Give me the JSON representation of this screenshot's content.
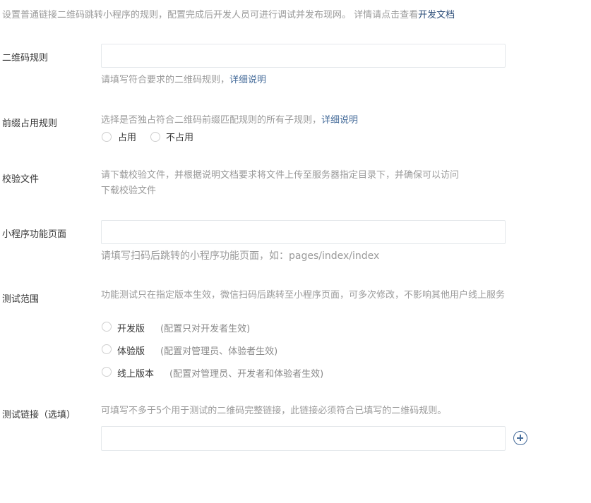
{
  "intro": {
    "text": "设置普通链接二维码跳转小程序的规则，配置完成后开发人员可进行调试并发布现网。 详情请点击查看",
    "link": "开发文档"
  },
  "qr_rule": {
    "label": "二维码规则",
    "value": "",
    "placeholder": "",
    "hint": "请填写符合要求的二维码规则，",
    "hint_link": "详细说明"
  },
  "prefix_rule": {
    "label": "前缀占用规则",
    "hint": "选择是否独占符合二维码前缀匹配规则的所有子规则，",
    "hint_link": "详细说明",
    "options": [
      "占用",
      "不占用"
    ]
  },
  "verify_file": {
    "label": "校验文件",
    "hint": "请下载校验文件，并根据说明文档要求将文件上传至服务器指定目录下，并确保可以访问",
    "download_link": "下载校验文件"
  },
  "mp_page": {
    "label": "小程序功能页面",
    "value": "",
    "placeholder": "",
    "hint": "请填写扫码后跳转的小程序功能页面，如：pages/index/index"
  },
  "test_scope": {
    "label": "测试范围",
    "hint": "功能测试只在指定版本生效，微信扫码后跳转至小程序页面，可多次修改，不影响其他用户线上服务",
    "options": [
      {
        "label": "开发版",
        "note": "(配置只对开发者生效)"
      },
      {
        "label": "体验版",
        "note": "(配置对管理员、体验者生效)"
      },
      {
        "label": "线上版本",
        "note": "(配置对管理员、开发者和体验者生效)"
      }
    ]
  },
  "test_link": {
    "label": "测试链接（选填）",
    "hint": "可填写不多于5个用于测试的二维码完整链接，此链接必须符合已填写的二维码规则。",
    "value": "",
    "placeholder": "",
    "add_icon": "plus-circle-icon"
  },
  "colors": {
    "link": "#466c9a",
    "hint": "#9a9a9a",
    "text": "#353535",
    "border": "#e4e8eb"
  }
}
